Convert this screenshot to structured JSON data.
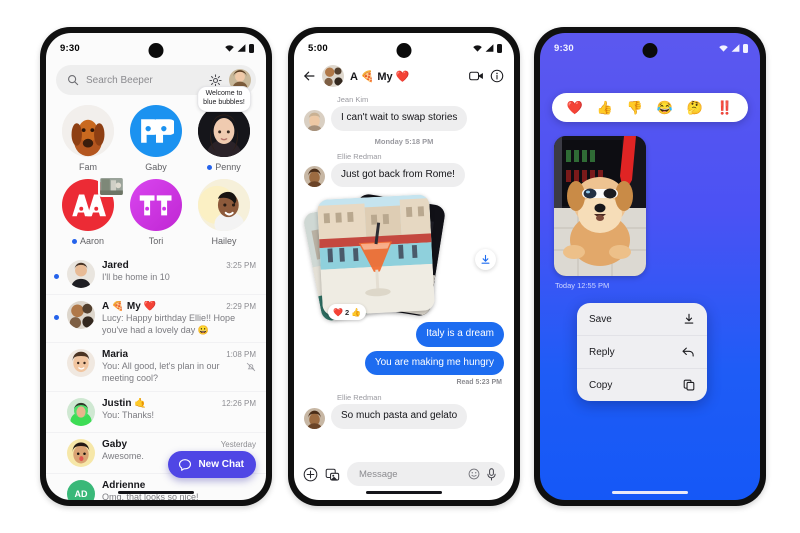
{
  "app": {
    "name": "Beeper",
    "accent": "#4f46e5",
    "bubble_out": "#1d6cf0",
    "bubble_in": "#eeeeef"
  },
  "phone1": {
    "status": {
      "time": "9:30"
    },
    "search": {
      "placeholder": "Search Beeper",
      "icon": "search-icon",
      "settings_icon": "gear-icon",
      "avatar": "profile-avatar"
    },
    "people": [
      {
        "name": "Fam",
        "unread": false,
        "tooltip": ""
      },
      {
        "name": "Gaby",
        "unread": false,
        "tooltip": ""
      },
      {
        "name": "Penny",
        "unread": true,
        "tooltip": "Welcome to\nblue bubbles!"
      },
      {
        "name": "Aaron",
        "unread": true,
        "tooltip": ""
      },
      {
        "name": "Tori",
        "unread": false,
        "tooltip": ""
      },
      {
        "name": "Hailey",
        "unread": false,
        "tooltip": ""
      }
    ],
    "chats": [
      {
        "name": "Jared",
        "preview": "I'll be home in 10",
        "time": "3:25 PM",
        "unread": true,
        "muted": false
      },
      {
        "name": "A 🍕 My ❤️",
        "preview": "Lucy: Happy birthday Ellie!! Hope you've had a lovely day  😀",
        "time": "2:29 PM",
        "unread": true,
        "muted": false
      },
      {
        "name": "Maria",
        "preview": "You: All good, let's plan in our meeting cool?",
        "time": "1:08 PM",
        "unread": false,
        "muted": true
      },
      {
        "name": "Justin 🤙",
        "preview": "You: Thanks!",
        "time": "12:26 PM",
        "unread": false,
        "muted": false
      },
      {
        "name": "Gaby",
        "preview": "Awesome.",
        "time": "Yesterday",
        "unread": false,
        "muted": false
      },
      {
        "name": "Adrienne",
        "preview": "Omg, that looks so nice!",
        "time": "",
        "unread": false,
        "muted": false
      }
    ],
    "fab": {
      "label": "New Chat",
      "icon": "chat-bubble-icon"
    }
  },
  "phone2": {
    "status": {
      "time": "5:00"
    },
    "header": {
      "title": "A 🍕 My ❤️",
      "back_icon": "back-arrow-icon",
      "video_icon": "video-camera-icon",
      "info_icon": "info-circle-icon"
    },
    "messages": [
      {
        "type": "sender",
        "text": "Jean Kim"
      },
      {
        "type": "in",
        "text": "I can't wait to swap stories"
      },
      {
        "type": "daystamp",
        "text": "Monday 5:18 PM"
      },
      {
        "type": "sender",
        "text": "Ellie Redman"
      },
      {
        "type": "in",
        "text": "Just got back from Rome!"
      },
      {
        "type": "photos",
        "reaction_emoji": "❤️",
        "reaction_count": "2",
        "reaction_extra": "👍",
        "download_icon": "download-icon"
      },
      {
        "type": "out",
        "text": "Italy is a dream"
      },
      {
        "type": "out",
        "text": "You are making me hungry"
      },
      {
        "type": "read",
        "text": "Read  5:23 PM"
      },
      {
        "type": "sender",
        "text": "Ellie Redman"
      },
      {
        "type": "in",
        "text": "So much pasta and gelato"
      }
    ],
    "composer": {
      "placeholder": "Message",
      "plus_icon": "plus-circle-icon",
      "gallery_icon": "image-picker-icon",
      "emoji_icon": "emoji-smiley-icon",
      "mic_icon": "microphone-icon"
    }
  },
  "phone3": {
    "status": {
      "time": "9:30"
    },
    "reactions": [
      "❤️",
      "👍",
      "👎",
      "😂",
      "🤔",
      "‼️"
    ],
    "reaction_names": [
      "heart-reaction",
      "thumbs-up-reaction",
      "thumbs-down-reaction",
      "laughing-reaction",
      "thinking-reaction",
      "double-exclamation-reaction"
    ],
    "photo_caption": "Today  12:55 PM",
    "menu": [
      {
        "label": "Save",
        "icon": "download-icon"
      },
      {
        "label": "Reply",
        "icon": "reply-arrow-icon"
      },
      {
        "label": "Copy",
        "icon": "copy-icon"
      }
    ]
  }
}
